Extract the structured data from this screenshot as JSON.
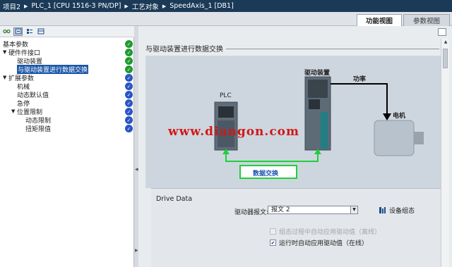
{
  "breadcrumb": [
    "项目2",
    "PLC_1 [CPU 1516-3 PN/DP]",
    "工艺对象",
    "SpeedAxis_1 [DB1]"
  ],
  "tabs": {
    "active": "功能视图",
    "inactive": "参数视图"
  },
  "tree": {
    "items": [
      {
        "label": "基本参数",
        "status": "green"
      },
      {
        "label": "硬件件接口",
        "status": "green"
      },
      {
        "label": "驱动装置",
        "status": "green"
      },
      {
        "label": "与驱动装置进行数据交换",
        "status": "green"
      },
      {
        "label": "扩展参数",
        "status": "blue"
      },
      {
        "label": "机械",
        "status": "blue"
      },
      {
        "label": "动态默认值",
        "status": "blue"
      },
      {
        "label": "急停",
        "status": "blue"
      },
      {
        "label": "位置限制",
        "status": "blue"
      },
      {
        "label": "动态限制",
        "status": "blue"
      },
      {
        "label": "扭矩限值",
        "status": "blue"
      }
    ]
  },
  "section": {
    "title": "与驱动装置进行数据交换"
  },
  "diagram": {
    "plc_label": "PLC",
    "drive_label": "驱动装置",
    "power_label": "功率",
    "motor_label": "电机",
    "data_exchange_label": "数据交换",
    "watermark": "www.diangon.com",
    "link_color": "#1fcf3a"
  },
  "drive_data": {
    "title": "Drive Data",
    "telegram_label": "驱动器报文:",
    "telegram_value": "报文 2",
    "device_config_label": "设备组态",
    "checkbox_runtime_label": "组态过程中自动应用驱动值（离线）",
    "checkbox_runtime_checked": false,
    "checkbox_runtime_enabled": false,
    "checkbox_online_label": "运行时自动应用驱动值（在线）",
    "checkbox_online_checked": true,
    "checkbox_online_enabled": true
  },
  "colors": {
    "titlebar": "#1b3a57",
    "status_green": "#1f9a2f",
    "status_blue": "#2a55c2",
    "selection": "#1b57a8"
  }
}
